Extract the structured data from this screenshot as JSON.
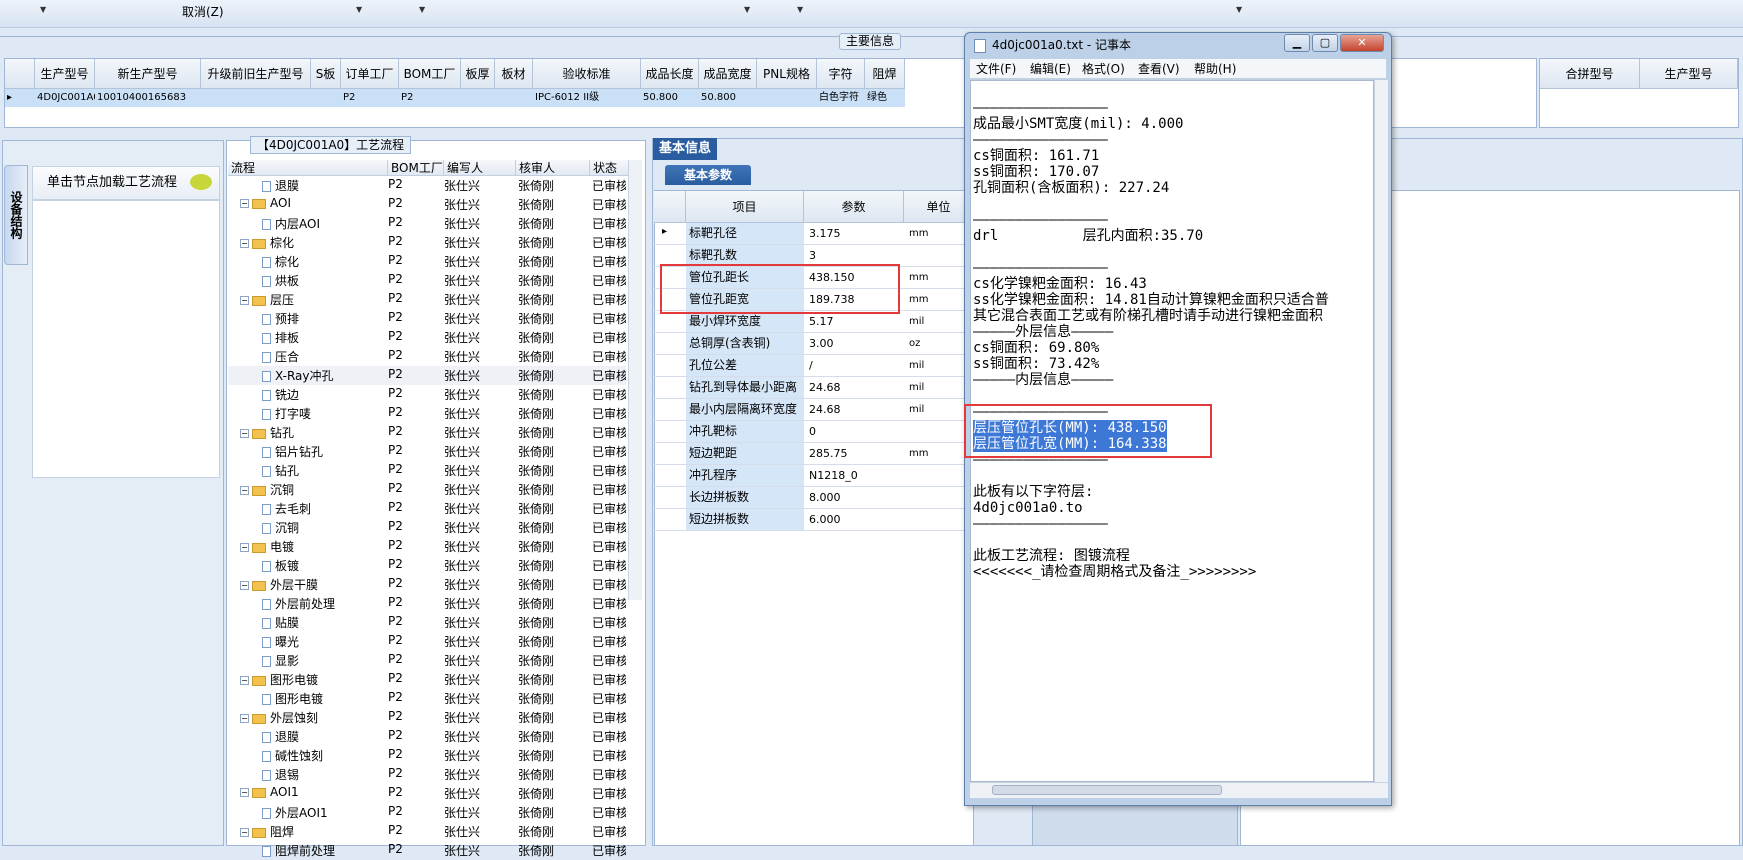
{
  "toolbar": {
    "cancel_label": "取消(Z)"
  },
  "main_info": {
    "label": "主要信息",
    "columns": [
      "生产型号",
      "新生产型号",
      "升级前旧生产型号",
      "S板",
      "订单工厂",
      "BOM工厂",
      "板厚",
      "板材",
      "验收标准",
      "成品长度",
      "成品宽度",
      "PNL规格",
      "字符",
      "阻焊"
    ],
    "row": [
      "4D0JC001A0",
      "10010400165683",
      "",
      "",
      "P2",
      "P2",
      "",
      "",
      "IPC-6012 II级",
      "50.800",
      "50.800",
      "",
      "白色字符",
      "绿色"
    ],
    "right_columns": [
      "合拼型号",
      "生产型号"
    ]
  },
  "left_panel": {
    "vertical_tab": "设备结构",
    "load_node": "单击节点加载工艺流程"
  },
  "process": {
    "title": "【4D0JC001A0】工艺流程",
    "columns": [
      "流程",
      "BOM工厂",
      "编写人",
      "核审人",
      "状态"
    ],
    "rows": [
      {
        "name": "退膜",
        "level": 1,
        "f": "P2",
        "w": "张仕兴",
        "r": "张倚刚",
        "s": "已审核"
      },
      {
        "name": "AOI",
        "level": 0,
        "f": "P2",
        "w": "张仕兴",
        "r": "张倚刚",
        "s": "已审核"
      },
      {
        "name": "内层AOI",
        "level": 1,
        "f": "P2",
        "w": "张仕兴",
        "r": "张倚刚",
        "s": "已审核"
      },
      {
        "name": "棕化",
        "level": 0,
        "f": "P2",
        "w": "张仕兴",
        "r": "张倚刚",
        "s": "已审核"
      },
      {
        "name": "棕化",
        "level": 1,
        "f": "P2",
        "w": "张仕兴",
        "r": "张倚刚",
        "s": "已审核"
      },
      {
        "name": "烘板",
        "level": 1,
        "f": "P2",
        "w": "张仕兴",
        "r": "张倚刚",
        "s": "已审核"
      },
      {
        "name": "层压",
        "level": 0,
        "f": "P2",
        "w": "张仕兴",
        "r": "张倚刚",
        "s": "已审核"
      },
      {
        "name": "预排",
        "level": 1,
        "f": "P2",
        "w": "张仕兴",
        "r": "张倚刚",
        "s": "已审核"
      },
      {
        "name": "排板",
        "level": 1,
        "f": "P2",
        "w": "张仕兴",
        "r": "张倚刚",
        "s": "已审核"
      },
      {
        "name": "压合",
        "level": 1,
        "f": "P2",
        "w": "张仕兴",
        "r": "张倚刚",
        "s": "已审核"
      },
      {
        "name": "X-Ray冲孔",
        "level": 1,
        "f": "P2",
        "w": "张仕兴",
        "r": "张倚刚",
        "s": "已审核"
      },
      {
        "name": "铣边",
        "level": 1,
        "f": "P2",
        "w": "张仕兴",
        "r": "张倚刚",
        "s": "已审核"
      },
      {
        "name": "打字唛",
        "level": 1,
        "f": "P2",
        "w": "张仕兴",
        "r": "张倚刚",
        "s": "已审核"
      },
      {
        "name": "钻孔",
        "level": 0,
        "f": "P2",
        "w": "张仕兴",
        "r": "张倚刚",
        "s": "已审核"
      },
      {
        "name": "铝片钻孔",
        "level": 1,
        "f": "P2",
        "w": "张仕兴",
        "r": "张倚刚",
        "s": "已审核"
      },
      {
        "name": "钻孔",
        "level": 1,
        "f": "P2",
        "w": "张仕兴",
        "r": "张倚刚",
        "s": "已审核"
      },
      {
        "name": "沉铜",
        "level": 0,
        "f": "P2",
        "w": "张仕兴",
        "r": "张倚刚",
        "s": "已审核"
      },
      {
        "name": "去毛刺",
        "level": 1,
        "f": "P2",
        "w": "张仕兴",
        "r": "张倚刚",
        "s": "已审核"
      },
      {
        "name": "沉铜",
        "level": 1,
        "f": "P2",
        "w": "张仕兴",
        "r": "张倚刚",
        "s": "已审核"
      },
      {
        "name": "电镀",
        "level": 0,
        "f": "P2",
        "w": "张仕兴",
        "r": "张倚刚",
        "s": "已审核"
      },
      {
        "name": "板镀",
        "level": 1,
        "f": "P2",
        "w": "张仕兴",
        "r": "张倚刚",
        "s": "已审核"
      },
      {
        "name": "外层干膜",
        "level": 0,
        "f": "P2",
        "w": "张仕兴",
        "r": "张倚刚",
        "s": "已审核"
      },
      {
        "name": "外层前处理",
        "level": 1,
        "f": "P2",
        "w": "张仕兴",
        "r": "张倚刚",
        "s": "已审核"
      },
      {
        "name": "贴膜",
        "level": 1,
        "f": "P2",
        "w": "张仕兴",
        "r": "张倚刚",
        "s": "已审核"
      },
      {
        "name": "曝光",
        "level": 1,
        "f": "P2",
        "w": "张仕兴",
        "r": "张倚刚",
        "s": "已审核"
      },
      {
        "name": "显影",
        "level": 1,
        "f": "P2",
        "w": "张仕兴",
        "r": "张倚刚",
        "s": "已审核"
      },
      {
        "name": "图形电镀",
        "level": 0,
        "f": "P2",
        "w": "张仕兴",
        "r": "张倚刚",
        "s": "已审核"
      },
      {
        "name": "图形电镀",
        "level": 1,
        "f": "P2",
        "w": "张仕兴",
        "r": "张倚刚",
        "s": "已审核"
      },
      {
        "name": "外层蚀刻",
        "level": 0,
        "f": "P2",
        "w": "张仕兴",
        "r": "张倚刚",
        "s": "已审核"
      },
      {
        "name": "退膜",
        "level": 1,
        "f": "P2",
        "w": "张仕兴",
        "r": "张倚刚",
        "s": "已审核"
      },
      {
        "name": "碱性蚀刻",
        "level": 1,
        "f": "P2",
        "w": "张仕兴",
        "r": "张倚刚",
        "s": "已审核"
      },
      {
        "name": "退锡",
        "level": 1,
        "f": "P2",
        "w": "张仕兴",
        "r": "张倚刚",
        "s": "已审核"
      },
      {
        "name": "AOI1",
        "level": 0,
        "f": "P2",
        "w": "张仕兴",
        "r": "张倚刚",
        "s": "已审核"
      },
      {
        "name": "外层AOI1",
        "level": 1,
        "f": "P2",
        "w": "张仕兴",
        "r": "张倚刚",
        "s": "已审核"
      },
      {
        "name": "阻焊",
        "level": 0,
        "f": "P2",
        "w": "张仕兴",
        "r": "张倚刚",
        "s": "已审核"
      },
      {
        "name": "阻焊前处理",
        "level": 1,
        "f": "P2",
        "w": "张仕兴",
        "r": "张倚刚",
        "s": "已审核"
      }
    ]
  },
  "basic_info": {
    "tab": "基本信息",
    "sub_tab": "基本参数",
    "columns": [
      "项目",
      "参数",
      "单位"
    ],
    "rows": [
      {
        "k": "标靶孔径",
        "v": "3.175",
        "u": "mm"
      },
      {
        "k": "标靶孔数",
        "v": "3",
        "u": ""
      },
      {
        "k": "管位孔距长",
        "v": "438.150",
        "u": "mm"
      },
      {
        "k": "管位孔距宽",
        "v": "189.738",
        "u": "mm"
      },
      {
        "k": "最小焊环宽度",
        "v": "5.17",
        "u": "mil"
      },
      {
        "k": "总铜厚(含表铜)",
        "v": "3.00",
        "u": "oz"
      },
      {
        "k": "孔位公差",
        "v": "/",
        "u": "mil"
      },
      {
        "k": "钻孔到导体最小距离",
        "v": "24.68",
        "u": "mil"
      },
      {
        "k": "最小内层隔离环宽度",
        "v": "24.68",
        "u": "mil"
      },
      {
        "k": "冲孔靶标",
        "v": "0",
        "u": ""
      },
      {
        "k": "短边靶距",
        "v": "285.75",
        "u": "mm"
      },
      {
        "k": "冲孔程序",
        "v": "N1218_0",
        "u": ""
      },
      {
        "k": "长边拼板数",
        "v": "8.000",
        "u": ""
      },
      {
        "k": "短边拼板数",
        "v": "6.000",
        "u": ""
      }
    ]
  },
  "notepad": {
    "title": "4d0jc001a0.txt - 记事本",
    "menu": [
      "文件(F)",
      "编辑(E)",
      "格式(O)",
      "查看(V)",
      "帮助(H)"
    ],
    "lines": [
      "————————————————",
      "成品最小SMT宽度(mil): 4.000",
      "————————————————",
      "cs铜面积: 161.71",
      "ss铜面积: 170.07",
      "孔铜面积(含板面积): 227.24",
      "",
      "————————————————",
      "drl          层孔内面积:35.70",
      "",
      "————————————————",
      "cs化学镍粑金面积: 16.43",
      "ss化学镍粑金面积: 14.81自动计算镍粑金面积只适合普",
      "其它混合表面工艺或有阶梯孔槽时请手动进行镍粑金面积",
      "—————外层信息—————",
      "cs铜面积: 69.80%",
      "ss铜面积: 73.42%",
      "—————内层信息—————",
      "",
      "————————————————",
      "层压管位孔长(MM): 438.150",
      "层压管位孔宽(MM): 164.338",
      "————————————————",
      "",
      "此板有以下字符层:",
      "4d0jc001a0.to",
      "————————————————",
      "",
      "此板工艺流程: 图镀流程",
      "<<<<<<<_请检查周期格式及备注_>>>>>>>>"
    ],
    "highlighted": [
      20,
      21
    ]
  },
  "colors": {
    "accent": "#2a5d9f",
    "selection": "#3d78d6",
    "annotation": "#e23a3a"
  }
}
